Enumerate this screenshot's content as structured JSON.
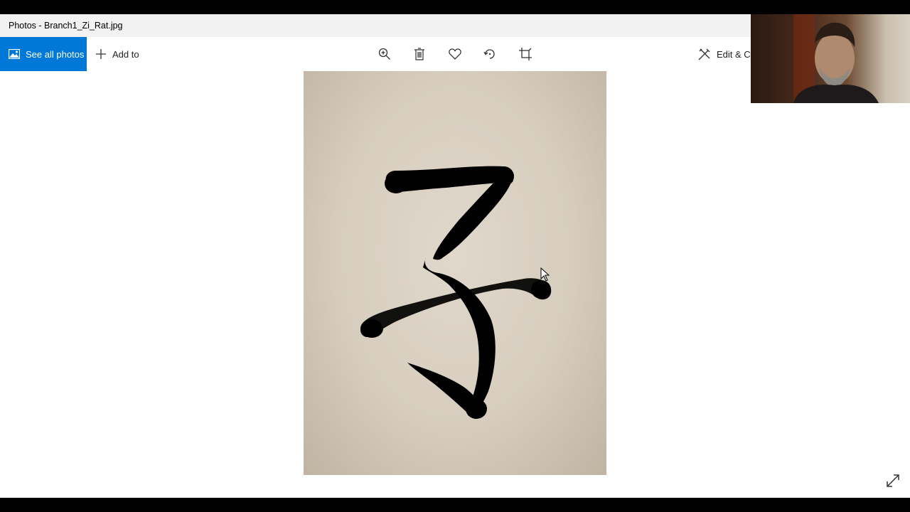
{
  "window": {
    "title": "Photos - Branch1_Zi_Rat.jpg"
  },
  "toolbar": {
    "see_all_label": "See all photos",
    "add_to_label": "Add to",
    "edit_create_label": "Edit & Cr",
    "tools": [
      "zoom-icon",
      "delete-icon",
      "favorite-icon",
      "rotate-icon",
      "crop-icon"
    ]
  },
  "colors": {
    "accent": "#0078d7",
    "titlebar": "#f2f2f2",
    "paper": "#d9d0c1",
    "ink": "#000000"
  }
}
